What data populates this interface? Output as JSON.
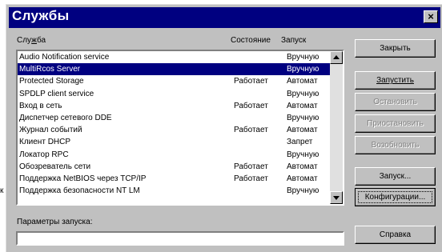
{
  "window": {
    "title": "Службы",
    "close_glyph": "×"
  },
  "columns": {
    "service": "Служба",
    "status": "Состояние",
    "startup": "Запуск"
  },
  "services": [
    {
      "name": "Audio Notification service",
      "status": "",
      "startup": "Вручную",
      "selected": false
    },
    {
      "name": "MultiRcos Server",
      "status": "",
      "startup": "Вручную",
      "selected": true
    },
    {
      "name": "Protected Storage",
      "status": "Работает",
      "startup": "Автомат",
      "selected": false
    },
    {
      "name": "SPDLP client service",
      "status": "",
      "startup": "Вручную",
      "selected": false
    },
    {
      "name": "Вход в сеть",
      "status": "Работает",
      "startup": "Автомат",
      "selected": false
    },
    {
      "name": "Диспетчер сетевого DDE",
      "status": "",
      "startup": "Вручную",
      "selected": false
    },
    {
      "name": "Журнал событий",
      "status": "Работает",
      "startup": "Автомат",
      "selected": false
    },
    {
      "name": "Клиент DHCP",
      "status": "",
      "startup": "Запрет",
      "selected": false
    },
    {
      "name": "Локатор RPC",
      "status": "",
      "startup": "Вручную",
      "selected": false
    },
    {
      "name": "Обозреватель сети",
      "status": "Работает",
      "startup": "Автомат",
      "selected": false
    },
    {
      "name": "Поддержка NetBIOS через TCP/IP",
      "status": "Работает",
      "startup": "Автомат",
      "selected": false
    },
    {
      "name": "Поддержка безопасности NT LM",
      "status": "",
      "startup": "Вручную",
      "selected": false
    }
  ],
  "buttons": {
    "close": "Закрыть",
    "start": "Запустить",
    "stop": "Остановить",
    "pause": "Приостановить",
    "resume": "Возобновить",
    "startup": "Запуск...",
    "hw_profiles": "Конфигурации...",
    "help": "Справка"
  },
  "params": {
    "label": "Параметры запуска:",
    "value": ""
  },
  "outside_glyph": "к"
}
